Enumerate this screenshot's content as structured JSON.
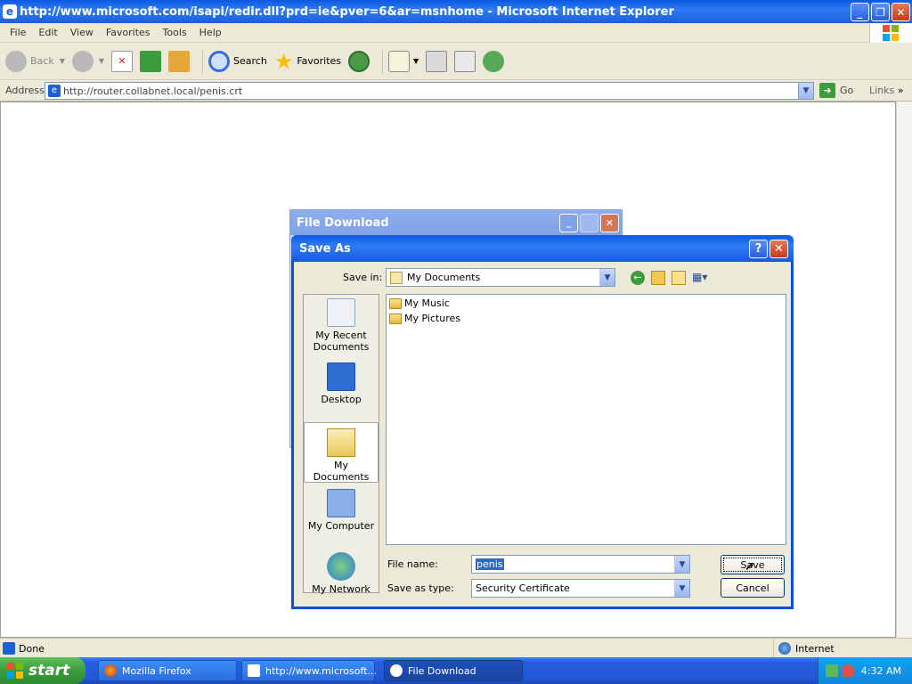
{
  "ie": {
    "title": "http://www.microsoft.com/isapi/redir.dll?prd=ie&pver=6&ar=msnhome - Microsoft Internet Explorer",
    "menu": [
      "File",
      "Edit",
      "View",
      "Favorites",
      "Tools",
      "Help"
    ],
    "toolbar": {
      "back": "Back",
      "search": "Search",
      "favorites": "Favorites"
    },
    "address_label": "Address",
    "address_value": "http://router.collabnet.local/penis.crt",
    "go": "Go",
    "links": "Links",
    "status_left": "Done",
    "status_zone": "Internet"
  },
  "file_download": {
    "title": "File Download"
  },
  "save_as": {
    "title": "Save As",
    "save_in_label": "Save in:",
    "save_in_value": "My Documents",
    "places": [
      "My Recent Documents",
      "Desktop",
      "My Documents",
      "My Computer",
      "My Network"
    ],
    "files": [
      "My Music",
      "My Pictures"
    ],
    "file_name_label": "File name:",
    "file_name_value": "penis",
    "save_type_label": "Save as type:",
    "save_type_value": "Security Certificate",
    "save_button": "Save",
    "cancel_button": "Cancel"
  },
  "taskbar": {
    "start": "start",
    "tasks": [
      "Mozilla Firefox",
      "http://www.microsoft...",
      "File Download"
    ],
    "clock": "4:32 AM"
  },
  "colors": {
    "title_blue": "#0a58e0",
    "dialog_bg": "#ece9d8",
    "selection": "#316ac5"
  }
}
